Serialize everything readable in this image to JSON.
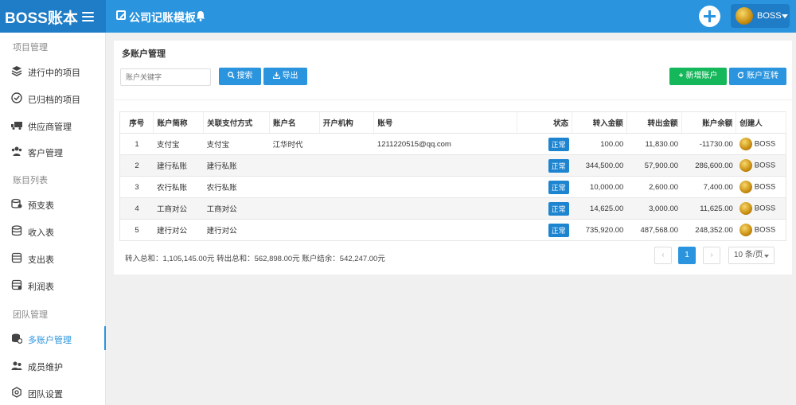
{
  "header": {
    "brand": "BOSS账本",
    "title": "公司记账模板",
    "user_name": "BOSS"
  },
  "sidebar": {
    "group1": "项目管理",
    "group2": "账目列表",
    "group3": "团队管理",
    "items": [
      {
        "label": "进行中的项目",
        "icon": "layers-icon"
      },
      {
        "label": "已归档的项目",
        "icon": "check-circle-icon"
      },
      {
        "label": "供应商管理",
        "icon": "truck-icon"
      },
      {
        "label": "客户管理",
        "icon": "users-icon"
      },
      {
        "label": "预支表",
        "icon": "coins-icon"
      },
      {
        "label": "收入表",
        "icon": "database-icon"
      },
      {
        "label": "支出表",
        "icon": "database-icon"
      },
      {
        "label": "利润表",
        "icon": "database-icon"
      },
      {
        "label": "多账户管理",
        "icon": "accounts-icon",
        "active": true
      },
      {
        "label": "成员维护",
        "icon": "user-group-icon"
      },
      {
        "label": "团队设置",
        "icon": "settings-icon"
      }
    ]
  },
  "main": {
    "title": "多账户管理",
    "search_placeholder": "账户关键字",
    "search_label": "搜索",
    "export_label": "导出",
    "add_label": "新增账户",
    "transfer_label": "账户互转",
    "columns": [
      "序号",
      "账户简称",
      "关联支付方式",
      "账户名",
      "开户机构",
      "账号",
      "状态",
      "转入金额",
      "转出金额",
      "账户余额",
      "创建人"
    ],
    "rows": [
      [
        "1",
        "支付宝",
        "支付宝",
        "江华时代",
        "",
        "1211220515@qq.com",
        "正常",
        "100.00",
        "11,830.00",
        "-11730.00",
        "BOSS"
      ],
      [
        "2",
        "建行私账",
        "建行私账",
        "",
        "",
        "",
        "正常",
        "344,500.00",
        "57,900.00",
        "286,600.00",
        "BOSS"
      ],
      [
        "3",
        "农行私账",
        "农行私账",
        "",
        "",
        "",
        "正常",
        "10,000.00",
        "2,600.00",
        "7,400.00",
        "BOSS"
      ],
      [
        "4",
        "工商对公",
        "工商对公",
        "",
        "",
        "",
        "正常",
        "14,625.00",
        "3,000.00",
        "11,625.00",
        "BOSS"
      ],
      [
        "5",
        "建行对公",
        "建行对公",
        "",
        "",
        "",
        "正常",
        "735,920.00",
        "487,568.00",
        "248,352.00",
        "BOSS"
      ]
    ],
    "summary": "转入总和：1,105,145.00元   转出总和：562,898.00元   账户结余：542,247.00元",
    "pagination": {
      "prev": "‹",
      "current": "1",
      "next": "›",
      "page_size": "10 条/页"
    }
  },
  "colors": {
    "header": "#2a94de",
    "brand": "#1f7cc6",
    "green": "#14b75a",
    "status": "#1d84d0"
  }
}
